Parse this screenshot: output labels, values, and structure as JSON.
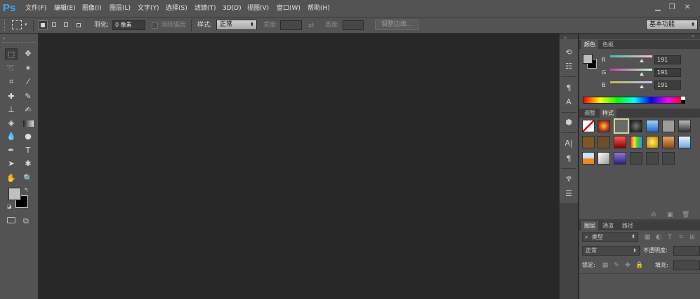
{
  "app": {
    "logo": "Ps"
  },
  "menu": [
    "文件(F)",
    "编辑(E)",
    "图像(I)",
    "图层(L)",
    "文字(Y)",
    "选择(S)",
    "滤镜(T)",
    "3D(D)",
    "视图(V)",
    "窗口(W)",
    "帮助(H)"
  ],
  "window_controls": {
    "minimize": "▁",
    "restore": "❐",
    "close": "✕"
  },
  "options": {
    "feather_label": "羽化:",
    "feather_value": "0 像素",
    "antialias_label": "消除锯齿",
    "style_label": "样式:",
    "style_value": "正常",
    "width_label": "宽度:",
    "height_label": "高度:",
    "refine_edge": "调整边缘...",
    "workspace": "基本功能"
  },
  "color_panel": {
    "tabs": [
      "颜色",
      "色板"
    ],
    "channels": [
      {
        "label": "R",
        "value": "191"
      },
      {
        "label": "G",
        "value": "191"
      },
      {
        "label": "B",
        "value": "191"
      }
    ],
    "foreground": "#bfbfbf",
    "background": "#000000"
  },
  "styles_panel": {
    "tabs": [
      "调整",
      "样式"
    ]
  },
  "layers_panel": {
    "tabs": [
      "图层",
      "通道",
      "路径"
    ],
    "filter_kind": "类型",
    "blend_mode": "正常",
    "opacity_label": "不透明度:",
    "lock_label": "锁定:",
    "fill_label": "填充:"
  },
  "colors": {
    "accent": "#43a5f0",
    "chrome": "#535353",
    "canvas": "#282828"
  }
}
